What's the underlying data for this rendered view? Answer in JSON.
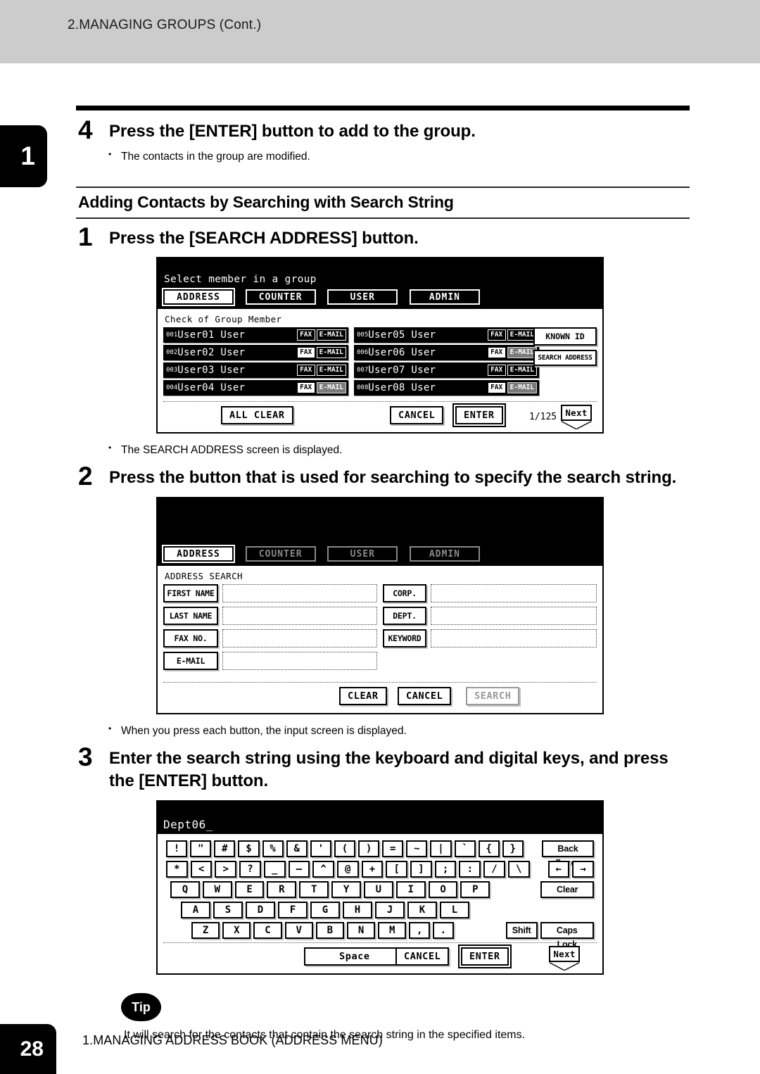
{
  "page": {
    "running_head": "2.MANAGING GROUPS (Cont.)",
    "chapter_tab": "1",
    "page_number": "28",
    "footer": "1.MANAGING ADDRESS BOOK (ADDRESS MENU)"
  },
  "steps": {
    "step4": {
      "number": "4",
      "title": "Press the [ENTER] button to add to the group.",
      "bullet": "The contacts in the group are modified."
    },
    "section_heading": "Adding Contacts by Searching with Search String",
    "step1": {
      "number": "1",
      "title": "Press the [SEARCH ADDRESS] button.",
      "bullet": "The SEARCH ADDRESS screen is displayed."
    },
    "step2": {
      "number": "2",
      "title": "Press the button that is used for searching to specify the search string.",
      "bullet": "When you press each button, the input screen is displayed."
    },
    "step3": {
      "number": "3",
      "title": "Enter the search string using the keyboard and digital keys, and press the [ENTER] button."
    }
  },
  "tip": {
    "label": "Tip",
    "text": "It will search for the contacts that contain the search string in the specified items."
  },
  "screen_group_member": {
    "title": "Select member in a group",
    "tabs": [
      {
        "label": "ADDRESS",
        "active": true
      },
      {
        "label": "COUNTER",
        "active": false
      },
      {
        "label": "USER",
        "active": false
      },
      {
        "label": "ADMIN",
        "active": false
      }
    ],
    "subtitle": "Check of Group Member",
    "members_left": [
      {
        "index": "001",
        "name": "User01 User",
        "fax": "FAX",
        "email": "E-MAIL",
        "fax_state": "off",
        "email_state": "off"
      },
      {
        "index": "002",
        "name": "User02 User",
        "fax": "FAX",
        "email": "E-MAIL",
        "fax_state": "on",
        "email_state": "off"
      },
      {
        "index": "003",
        "name": "User03 User",
        "fax": "FAX",
        "email": "E-MAIL",
        "fax_state": "off",
        "email_state": "off"
      },
      {
        "index": "004",
        "name": "User04 User",
        "fax": "FAX",
        "email": "E-MAIL",
        "fax_state": "on",
        "email_state": "gray"
      }
    ],
    "members_right": [
      {
        "index": "005",
        "name": "User05 User",
        "fax": "FAX",
        "email": "E-MAIL",
        "fax_state": "off",
        "email_state": "off"
      },
      {
        "index": "006",
        "name": "User06 User",
        "fax": "FAX",
        "email": "E-MAIL",
        "fax_state": "on",
        "email_state": "gray"
      },
      {
        "index": "007",
        "name": "User07 User",
        "fax": "FAX",
        "email": "E-MAIL",
        "fax_state": "off",
        "email_state": "off"
      },
      {
        "index": "008",
        "name": "User08 User",
        "fax": "FAX",
        "email": "E-MAIL",
        "fax_state": "on",
        "email_state": "gray"
      }
    ],
    "side_buttons": [
      {
        "label": "KNOWN ID"
      },
      {
        "label": "SEARCH ADDRESS"
      }
    ],
    "all_clear": "ALL CLEAR",
    "cancel": "CANCEL",
    "enter": "ENTER",
    "page_indicator": "1/125",
    "next": "Next"
  },
  "screen_address_search": {
    "tabs": [
      {
        "label": "ADDRESS",
        "active": true
      },
      {
        "label": "COUNTER",
        "active": false
      },
      {
        "label": "USER",
        "active": false
      },
      {
        "label": "ADMIN",
        "active": false
      }
    ],
    "subtitle": "ADDRESS SEARCH",
    "fields_left": [
      {
        "label": "FIRST NAME",
        "value": ""
      },
      {
        "label": "LAST NAME",
        "value": ""
      },
      {
        "label": "FAX NO.",
        "value": ""
      },
      {
        "label": "E-MAIL",
        "value": ""
      }
    ],
    "fields_right": [
      {
        "label": "CORP.",
        "value": ""
      },
      {
        "label": "DEPT.",
        "value": ""
      },
      {
        "label": "KEYWORD",
        "value": ""
      }
    ],
    "clear": "CLEAR",
    "cancel": "CANCEL",
    "search": "SEARCH"
  },
  "screen_keyboard": {
    "input_value": "Dept06_",
    "row_symbols_1": [
      "!",
      "\"",
      "#",
      "$",
      "%",
      "&",
      "'",
      "(",
      ")",
      "=",
      "~",
      "|",
      "`",
      "{",
      "}"
    ],
    "row_symbols_2": [
      "*",
      "<",
      ">",
      "?",
      "_",
      "—",
      "^",
      "@",
      "+",
      "[",
      "]",
      ";",
      ":",
      "/",
      "\\"
    ],
    "row_letters_1": [
      "Q",
      "W",
      "E",
      "R",
      "T",
      "Y",
      "U",
      "I",
      "O",
      "P"
    ],
    "row_letters_2": [
      "A",
      "S",
      "D",
      "F",
      "G",
      "H",
      "J",
      "K",
      "L"
    ],
    "row_letters_3": [
      "Z",
      "X",
      "C",
      "V",
      "B",
      "N",
      "M",
      ",",
      "."
    ],
    "back_space": "Back Space",
    "arrow_left": "←",
    "arrow_right": "→",
    "clear": "Clear",
    "shift": "Shift",
    "caps_lock": "Caps Lock",
    "space": "Space",
    "cancel": "CANCEL",
    "enter": "ENTER",
    "next": "Next"
  }
}
